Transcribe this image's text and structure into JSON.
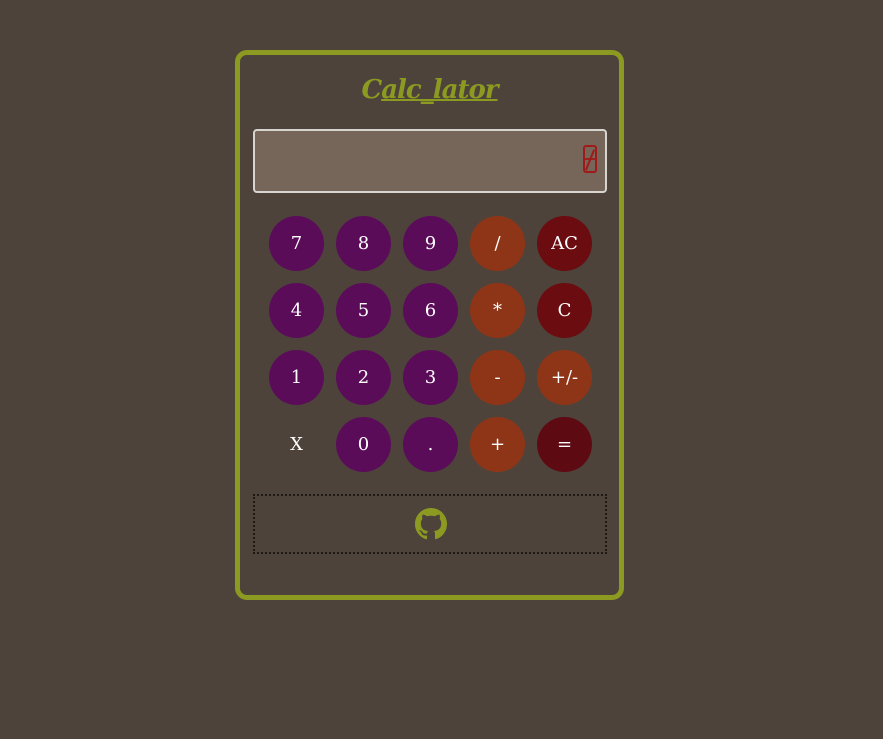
{
  "app": {
    "title_prefix": "C",
    "title_rest": "alc_lator"
  },
  "display": {
    "value": ""
  },
  "keys": {
    "row1": [
      "7",
      "8",
      "9",
      "/",
      "AC"
    ],
    "row2": [
      "4",
      "5",
      "6",
      "*",
      "C"
    ],
    "row3": [
      "1",
      "2",
      "3",
      "-",
      "+/-"
    ],
    "row4": [
      "X",
      "0",
      ".",
      "+",
      "="
    ]
  },
  "footer": {
    "icon": "github-icon"
  },
  "colors": {
    "background": "#4d433b",
    "accent": "#8c9a22",
    "number_key": "#5a0c59",
    "operator_key": "#8f3517",
    "clear_key": "#6a0c10",
    "equals_key": "#5e0a12",
    "display_bg": "#76665a"
  }
}
